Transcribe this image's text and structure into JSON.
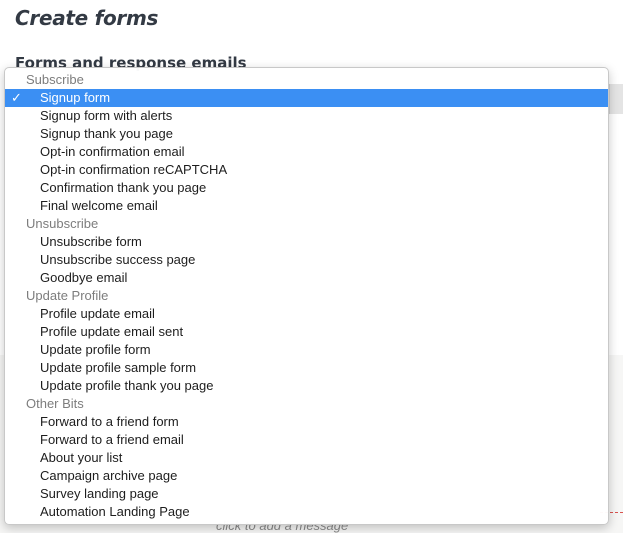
{
  "page": {
    "title": "Create forms",
    "section_title": "Forms and response emails"
  },
  "backdrop": {
    "message_hint": "click to add a message"
  },
  "dropdown": {
    "selected": "Signup form",
    "groups": [
      {
        "label": "Subscribe",
        "options": [
          "Signup form",
          "Signup form with alerts",
          "Signup thank you page",
          "Opt-in confirmation email",
          "Opt-in confirmation reCAPTCHA",
          "Confirmation thank you page",
          "Final welcome email"
        ]
      },
      {
        "label": "Unsubscribe",
        "options": [
          "Unsubscribe form",
          "Unsubscribe success page",
          "Goodbye email"
        ]
      },
      {
        "label": "Update Profile",
        "options": [
          "Profile update email",
          "Profile update email sent",
          "Update profile form",
          "Update profile sample form",
          "Update profile thank you page"
        ]
      },
      {
        "label": "Other Bits",
        "options": [
          "Forward to a friend form",
          "Forward to a friend email",
          "About your list",
          "Campaign archive page",
          "Survey landing page",
          "Automation Landing Page"
        ]
      }
    ]
  },
  "icons": {
    "check": "✓"
  },
  "colors": {
    "selection": "#3b8ff3",
    "heading": "#333a44",
    "group_label": "#7d7d7d"
  }
}
